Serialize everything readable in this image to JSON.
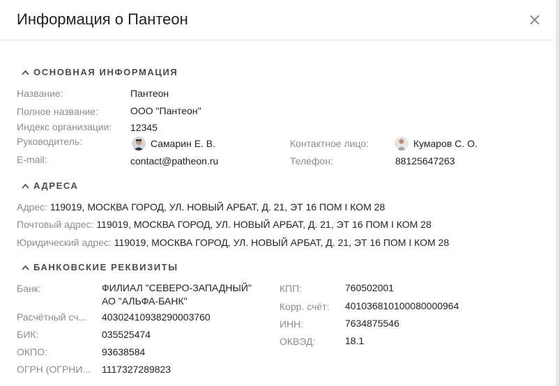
{
  "dialog": {
    "title": "Информация о Пантеон",
    "close_symbol": "×"
  },
  "sections": {
    "basic": {
      "title": "ОСНОВНАЯ ИНФОРМАЦИЯ",
      "name_label": "Название:",
      "name_value": "Пантеон",
      "fullname_label": "Полное название:",
      "fullname_value": "ООО \"Пантеон\"",
      "index_label": "Индекс организации:",
      "index_value": "12345",
      "head_label": "Руководитель:",
      "head_value": "Самарин Е. В.",
      "contact_label": "Контактное лицо:",
      "contact_value": "Кумаров С. О.",
      "email_label": "E-mail:",
      "email_value": "contact@patheon.ru",
      "phone_label": "Телефон:",
      "phone_value": "88125647263"
    },
    "addresses": {
      "title": "АДРЕСА",
      "address_label": "Адрес:",
      "address_value": "119019, МОСКВА ГОРОД, УЛ. НОВЫЙ АРБАТ, Д. 21, ЭТ 16 ПОМ I КОМ 28",
      "postal_label": "Почтовый адрес:",
      "postal_value": "119019, МОСКВА ГОРОД, УЛ. НОВЫЙ АРБАТ, Д. 21, ЭТ 16 ПОМ I КОМ 28",
      "legal_label": "Юридический адрес:",
      "legal_value": "119019, МОСКВА ГОРОД, УЛ. НОВЫЙ АРБАТ, Д. 21, ЭТ 16 ПОМ I КОМ 28"
    },
    "bank": {
      "title": "БАНКОВСКИЕ РЕКВИЗИТЫ",
      "bank_label": "Банк:",
      "bank_value_line1": "ФИЛИАЛ \"СЕВЕРО-ЗАПАДНЫЙ\"",
      "bank_value_line2": "АО \"АЛЬФА-БАНК\"",
      "account_label": "Расчётный сч...",
      "account_value": "40302410938290003760",
      "bik_label": "БИК:",
      "bik_value": "035525474",
      "okpo_label": "ОКПО:",
      "okpo_value": "93638584",
      "ogrn_label": "ОГРН (ОГРНИ...",
      "ogrn_value": "1117327289823",
      "kpp_label": "КПП:",
      "kpp_value": "760502001",
      "corr_label": "Корр. счёт:",
      "corr_value": "40103681010008000096​4",
      "inn_label": "ИНН:",
      "inn_value": "7634875546",
      "okved_label": "ОКВЭД:",
      "okved_value": "18.1"
    }
  },
  "colors": {
    "label": "#8c8c8c",
    "value": "#222222",
    "section": "#4a4a4a"
  }
}
